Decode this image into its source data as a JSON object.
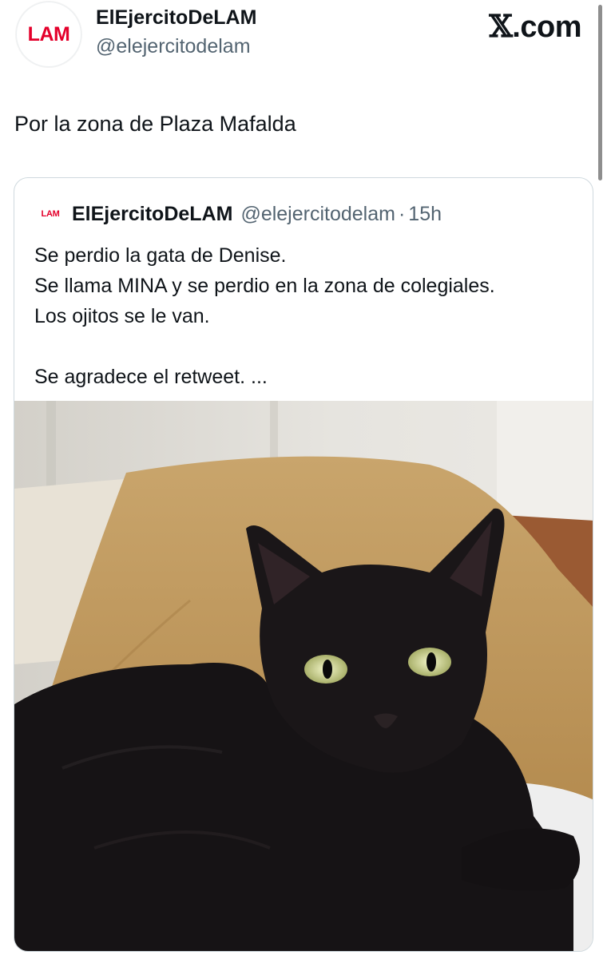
{
  "author": {
    "avatar_text": "LAM",
    "display_name": "ElEjercitoDeLAM",
    "handle": "@elejercitodelam"
  },
  "site": {
    "logo_glyph": "𝕏",
    "logo_text": ".com"
  },
  "tweet": {
    "text": "Por la zona de Plaza Mafalda"
  },
  "quoted": {
    "avatar_text": "LAM",
    "display_name": "ElEjercitoDeLAM",
    "handle": "@elejercitodelam",
    "separator": "·",
    "time": "15h",
    "lines": [
      "Se perdio la gata de Denise.",
      "Se llama MINA y se perdio en la zona de colegiales.",
      "Los ojitos se le van.",
      "",
      "Se agradece el retweet. ..."
    ]
  },
  "colors": {
    "brand_red": "#e4002b",
    "text": "#0f1419",
    "secondary": "#536471",
    "border": "#cfd9de"
  }
}
